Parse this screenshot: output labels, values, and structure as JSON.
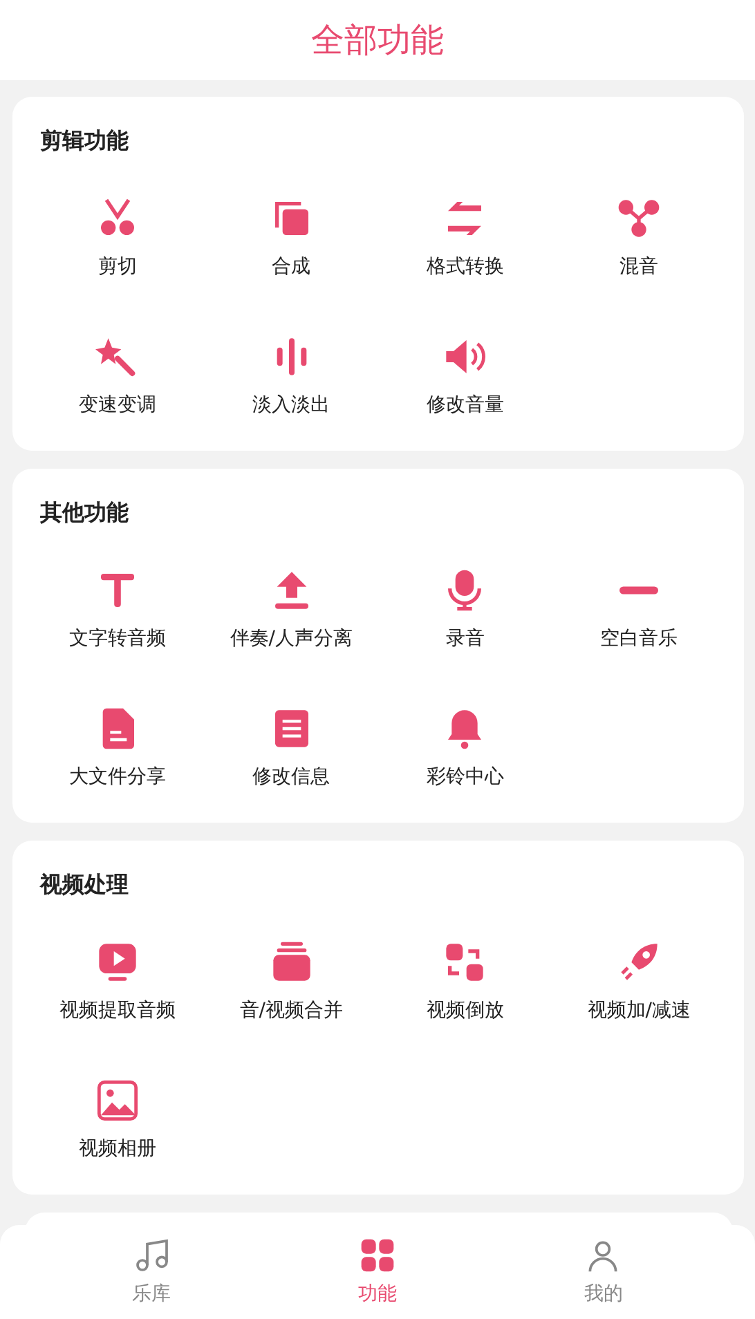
{
  "header": {
    "title": "全部功能"
  },
  "sections": [
    {
      "title": "剪辑功能",
      "items": [
        {
          "label": "剪切"
        },
        {
          "label": "合成"
        },
        {
          "label": "格式转换"
        },
        {
          "label": "混音"
        },
        {
          "label": "变速变调"
        },
        {
          "label": "淡入淡出"
        },
        {
          "label": "修改音量"
        }
      ]
    },
    {
      "title": "其他功能",
      "items": [
        {
          "label": "文字转音频"
        },
        {
          "label": "伴奏/人声分离"
        },
        {
          "label": "录音"
        },
        {
          "label": "空白音乐"
        },
        {
          "label": "大文件分享"
        },
        {
          "label": "修改信息"
        },
        {
          "label": "彩铃中心"
        }
      ]
    },
    {
      "title": "视频处理",
      "items": [
        {
          "label": "视频提取音频"
        },
        {
          "label": "音/视频合并"
        },
        {
          "label": "视频倒放"
        },
        {
          "label": "视频加/减速"
        },
        {
          "label": "视频相册"
        }
      ]
    }
  ],
  "tabs": [
    {
      "label": "乐库",
      "selected": false
    },
    {
      "label": "功能",
      "selected": true
    },
    {
      "label": "我的",
      "selected": false
    }
  ]
}
